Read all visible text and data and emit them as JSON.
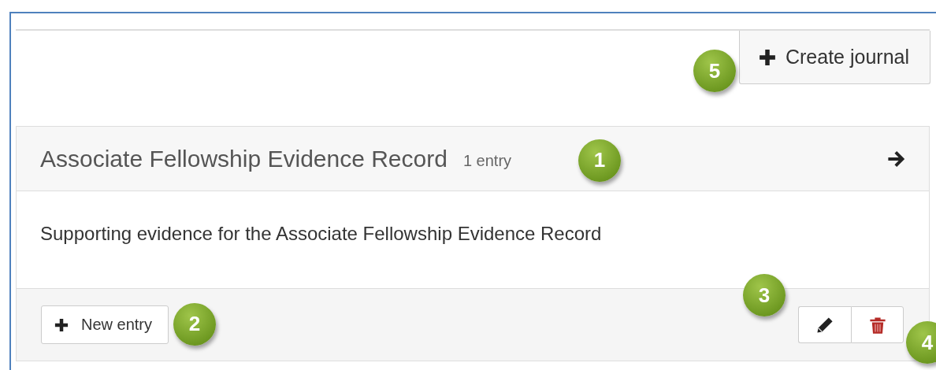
{
  "create_journal_button": {
    "label": "Create journal",
    "callout": "5"
  },
  "journal": {
    "title": "Associate Fellowship Evidence Record",
    "entry_count": "1 entry",
    "callout": "1",
    "description": "Supporting evidence for the Associate Fellowship Evidence Record",
    "new_entry_button": {
      "label": "New entry",
      "callout": "2"
    },
    "edit_button": {
      "callout": "3"
    },
    "delete_button": {
      "callout": "4"
    }
  }
}
